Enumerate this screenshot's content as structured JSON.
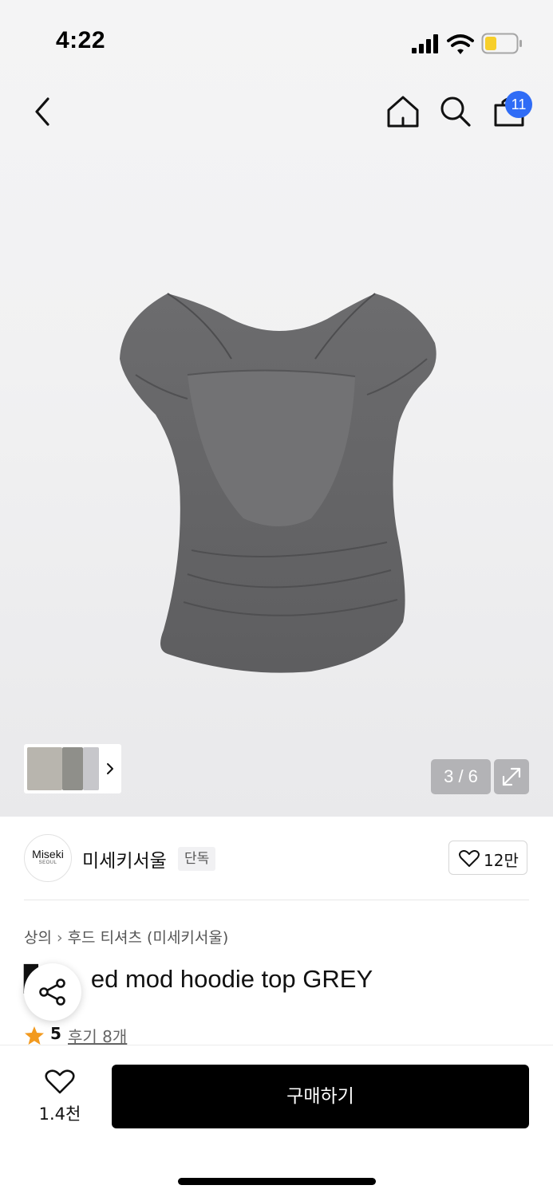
{
  "status_bar": {
    "time": "4:22",
    "battery_color": "#f7cf2b"
  },
  "nav": {
    "back_icon": "chevron-left-icon",
    "home_icon": "home-icon",
    "search_icon": "search-icon",
    "cart_icon": "shopping-bag-icon",
    "cart_count": "11",
    "badge_color": "#2f6cf6"
  },
  "gallery": {
    "counter": "3 / 6",
    "expand_icon": "expand-arrows-icon",
    "thumbs_more_icon": "chevron-right-icon"
  },
  "brand": {
    "logo_text": "Miseki",
    "logo_subtext": "SEOUL",
    "name": "미세키서울",
    "badge": "단독",
    "like_count": "12만"
  },
  "product": {
    "breadcrumb": [
      "상의",
      "후드 티셔츠 (미세키서울)"
    ],
    "title": "ed mod hoodie top GREY",
    "title_prefix_glyph": "▊",
    "rating": {
      "star_color": "#f29a1f",
      "score": "5",
      "reviews": "후기 8개"
    },
    "share_icon": "share-icon"
  },
  "bottom_bar": {
    "wish_count": "1.4천",
    "buy_label": "구매하기"
  }
}
